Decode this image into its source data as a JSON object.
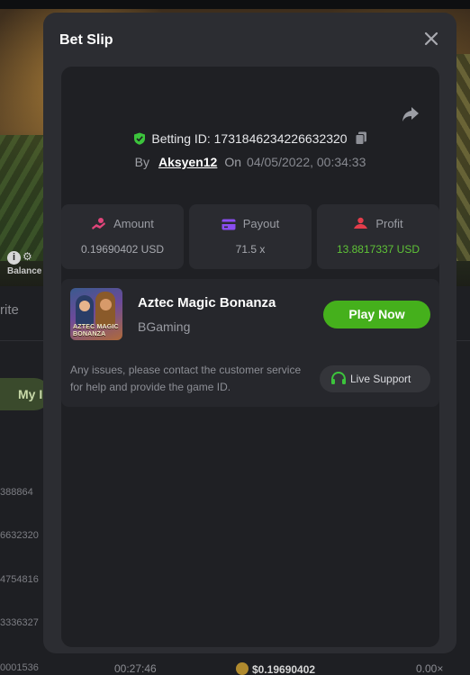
{
  "background": {
    "balance_label": "Balance",
    "info_glyph": "i",
    "write_fragment": "rite",
    "my_bets_fragment": "My I",
    "row_ids": [
      "388864",
      "6632320",
      "4754816",
      "3336327",
      "0001536"
    ],
    "bottom_time": "00:27:46",
    "bottom_amount": "$0.19690402",
    "bottom_multiplier": "0.00×"
  },
  "modal": {
    "title": "Bet Slip",
    "close_glyph": "✕"
  },
  "bet": {
    "id_label": "Betting ID: 1731846234226632320",
    "by_label": "By",
    "user": "Aksyen12",
    "on_label": "On",
    "date": "04/05/2022, 00:34:33"
  },
  "stats": {
    "amount": {
      "label": "Amount",
      "value": "0.19690402 USD"
    },
    "payout": {
      "label": "Payout",
      "value": "71.5 x"
    },
    "profit": {
      "label": "Profit",
      "value": "13.8817337 USD"
    }
  },
  "game": {
    "name": "Aztec Magic Bonanza",
    "provider": "BGaming",
    "thumb_logo": "AZTEC MAGIC BONANZA",
    "play_label": "Play Now"
  },
  "support": {
    "note": "Any issues, please contact the customer service for help and provide the game ID.",
    "button_label": "Live Support"
  },
  "colors": {
    "accent_green": "#45b01c",
    "profit_green": "#5fc337",
    "amount_icon": "#e0457a",
    "payout_icon": "#8a4df0",
    "profit_icon": "#e23d4b",
    "shield_green": "#3cc43c"
  },
  "icons": [
    "close-icon",
    "share-icon",
    "shield-icon",
    "copy-icon",
    "amount-icon",
    "payout-icon",
    "profit-icon",
    "headset-icon"
  ]
}
